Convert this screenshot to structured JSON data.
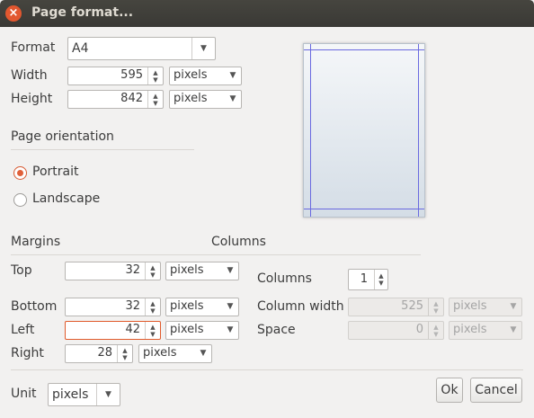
{
  "window": {
    "title": "Page format..."
  },
  "format": {
    "label": "Format",
    "value": "A4"
  },
  "width": {
    "label": "Width",
    "value": "595",
    "unit": "pixels"
  },
  "height": {
    "label": "Height",
    "value": "842",
    "unit": "pixels"
  },
  "orientation": {
    "section": "Page orientation",
    "portrait": "Portrait",
    "landscape": "Landscape",
    "selected": "Portrait"
  },
  "margins": {
    "section": "Margins",
    "top": {
      "label": "Top",
      "value": "32",
      "unit": "pixels"
    },
    "bottom": {
      "label": "Bottom",
      "value": "32",
      "unit": "pixels"
    },
    "left": {
      "label": "Left",
      "value": "42",
      "unit": "pixels"
    },
    "right": {
      "label": "Right",
      "value": "28",
      "unit": "pixels"
    }
  },
  "columns": {
    "section": "Columns",
    "columns": {
      "label": "Columns",
      "value": "1"
    },
    "column_width": {
      "label": "Column width",
      "value": "525",
      "unit": "pixels"
    },
    "space": {
      "label": "Space",
      "value": "0",
      "unit": "pixels"
    }
  },
  "unit": {
    "label": "Unit",
    "value": "pixels"
  },
  "buttons": {
    "ok": "Ok",
    "cancel": "Cancel"
  },
  "colors": {
    "accent": "#e05a2b",
    "titlebar": "#3c3b37",
    "guides": "#6a6ae0"
  }
}
